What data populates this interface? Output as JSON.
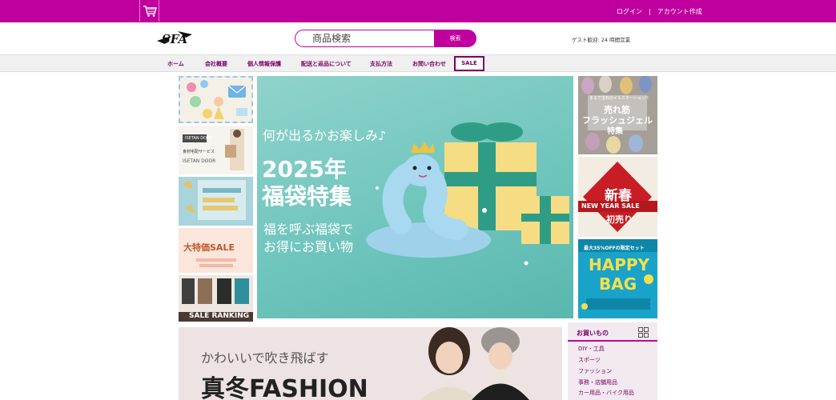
{
  "header": {
    "login_label": "ログイン",
    "separator": "|",
    "register_label": "アカウント作成",
    "logo_text": "SFA",
    "search_placeholder": "商品検索",
    "search_button": "検索",
    "guest_text": "ゲスト歓迎: 24 時間営業"
  },
  "nav": {
    "items": [
      "ホーム",
      "会社概要",
      "個人情報保護",
      "配送と返品について",
      "支払方法",
      "お問い合わせ",
      "SALE"
    ]
  },
  "left_banners": {
    "b2_brand": "ISETAN DOOR",
    "b2_caption": "食材宅配サービス",
    "b2_name": "ISETAN DOOR",
    "b4_title": "大特価SALE",
    "b5_title": "SALE RANKING"
  },
  "hero": {
    "line1": "何が出るかお楽しみ♪",
    "title_line1": "2025年",
    "title_line2": "福袋特集",
    "line2a": "福を呼ぶ福袋で",
    "line2b": "お得にお買い物"
  },
  "right_banners": {
    "r1_top": "まるで宝石のイルミネーション!!",
    "r1_title1": "売れ筋",
    "r1_title2": "フラッシュジェル",
    "r1_title3": "特集",
    "r2_title1": "新春",
    "r2_title2": "NEW YEAR SALE",
    "r2_title3": "初売り",
    "r3_top": "最大35%OFFの限定セット",
    "r3_title1": "HAPPY",
    "r3_title2": "BAG"
  },
  "bottom_banner": {
    "subtitle": "かわいいで吹き飛ばす",
    "title": "真冬FASHION"
  },
  "categories": {
    "heading": "お買いもの",
    "items": [
      "DIY・工具",
      "スポーツ",
      "ファッション",
      "事務・店舗用品",
      "カー用品・バイク用品"
    ]
  },
  "colors": {
    "brand": "#c0009e",
    "nav_text": "#7a0068",
    "hero_bg": "#6cc4bb"
  },
  "icons": [
    "cart-icon",
    "grid-icon"
  ]
}
